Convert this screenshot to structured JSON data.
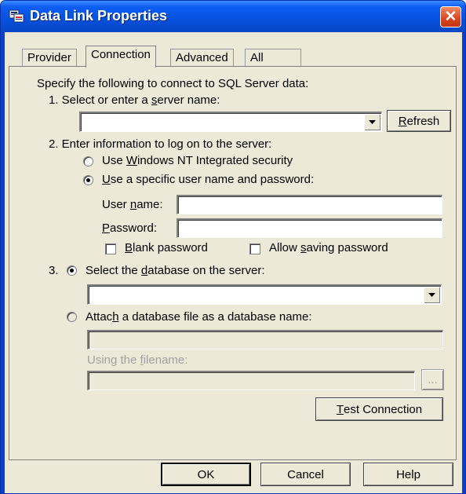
{
  "window": {
    "title": "Data Link Properties",
    "close_glyph": "✕"
  },
  "tabs": [
    {
      "label": "Provider",
      "active": false
    },
    {
      "label": "Connection",
      "active": true
    },
    {
      "label": "Advanced",
      "active": false
    },
    {
      "label": "All",
      "active": false
    }
  ],
  "connection": {
    "intro": "Specify the following to connect to SQL Server data:",
    "step1": {
      "label_pre": "1. Select or enter a ",
      "label_u": "s",
      "label_post": "erver name:",
      "server_value": "",
      "refresh_u": "R",
      "refresh_rest": "efresh"
    },
    "step2": {
      "label": "2. Enter information to log on to the server:",
      "opt_nt_pre": "Use ",
      "opt_nt_u": "W",
      "opt_nt_post": "indows NT Integrated security",
      "opt_nt_selected": false,
      "opt_user_u": "U",
      "opt_user_post": "se a specific user name and password:",
      "opt_user_selected": true,
      "username_pre": "User ",
      "username_u": "n",
      "username_post": "ame:",
      "username_value": "",
      "password_u": "P",
      "password_post": "assword:",
      "password_value": "",
      "blank_u": "B",
      "blank_post": "lank password",
      "blank_checked": false,
      "allow_pre": "Allow ",
      "allow_u": "s",
      "allow_post": "aving password",
      "allow_checked": false
    },
    "step3": {
      "number": "3.",
      "opt_select_pre": "Select the ",
      "opt_select_u": "d",
      "opt_select_post": "atabase on the server:",
      "opt_select_selected": true,
      "database_value": "",
      "opt_attach_pre": "Attac",
      "opt_attach_u": "h",
      "opt_attach_post": " a database file as a database name:",
      "opt_attach_selected": false,
      "attach_name_value": "",
      "filename_pre": "Using the ",
      "filename_u": "f",
      "filename_post": "ilename:",
      "filename_value": "",
      "browse_label": "..."
    },
    "test_u": "T",
    "test_post": "est Connection"
  },
  "footer": {
    "ok": "OK",
    "cancel": "Cancel",
    "help": "Help"
  },
  "colors": {
    "titlebar": "#0652e0",
    "dialog_face": "#ece9d8",
    "close_button": "#d9451f"
  }
}
